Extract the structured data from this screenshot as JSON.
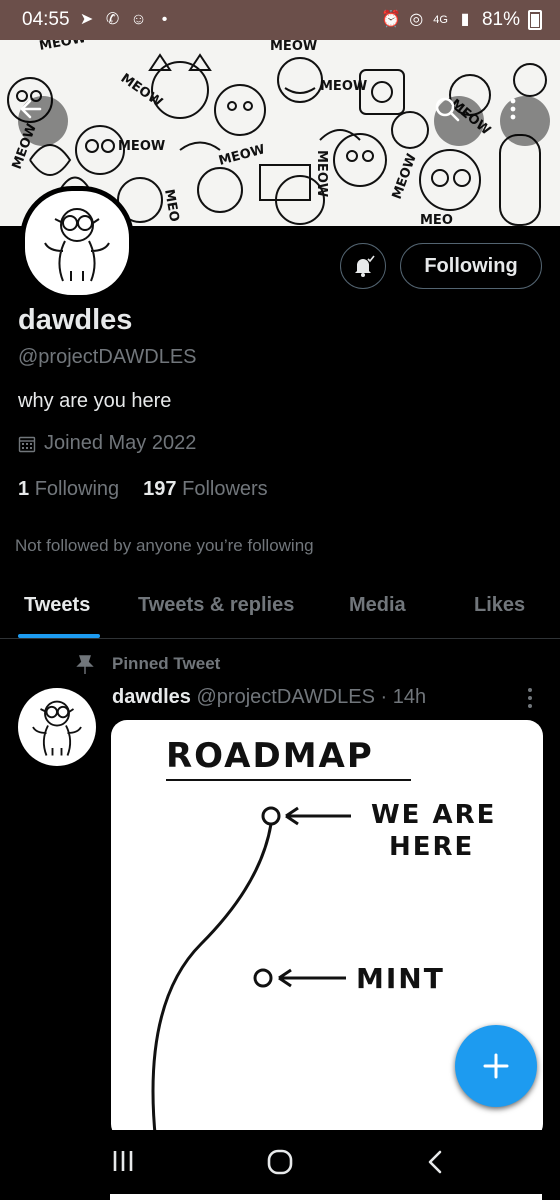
{
  "status_bar": {
    "time": "04:55",
    "network": "4G",
    "battery": "81%",
    "background_color": "#6b4f4a"
  },
  "profile": {
    "display_name": "dawdles",
    "handle": "@projectDAWDLES",
    "bio": "why are you here",
    "joined": "Joined May 2022",
    "following_count": "1",
    "following_label": "Following",
    "followers_count": "197",
    "followers_label": "Followers",
    "not_followed_note": "Not followed by anyone you’re following",
    "follow_button_label": "Following"
  },
  "banner": {
    "doodle_words": [
      "MEOW",
      "MEOW",
      "MEOW",
      "MEOW",
      "MEOW",
      "MEOW",
      "MEOW",
      "MEO",
      "MEO",
      "MEOW",
      "MEOW",
      "MEOW"
    ]
  },
  "tabs": [
    {
      "label": "Tweets",
      "active": true
    },
    {
      "label": "Tweets & replies",
      "active": false
    },
    {
      "label": "Media",
      "active": false
    },
    {
      "label": "Likes",
      "active": false
    }
  ],
  "pinned_tweet": {
    "pinned_label": "Pinned Tweet",
    "author_name": "dawdles",
    "author_handle": "@projectDAWDLES",
    "time": "· 14h",
    "image_text": {
      "title": "ROADMAP",
      "marker_1": "WE ARE",
      "marker_1b": "HERE",
      "marker_2": "MINT"
    }
  },
  "colors": {
    "accent": "#1d9bf0",
    "background": "#000000",
    "secondary_text": "#71767b",
    "primary_text": "#e7e9ea"
  },
  "icons": {
    "back": "arrow-left-icon",
    "search": "search-icon",
    "more": "more-vertical-icon",
    "notifications": "bell-icon",
    "pin": "pin-icon",
    "calendar": "calendar-icon",
    "compose": "plus-icon"
  }
}
